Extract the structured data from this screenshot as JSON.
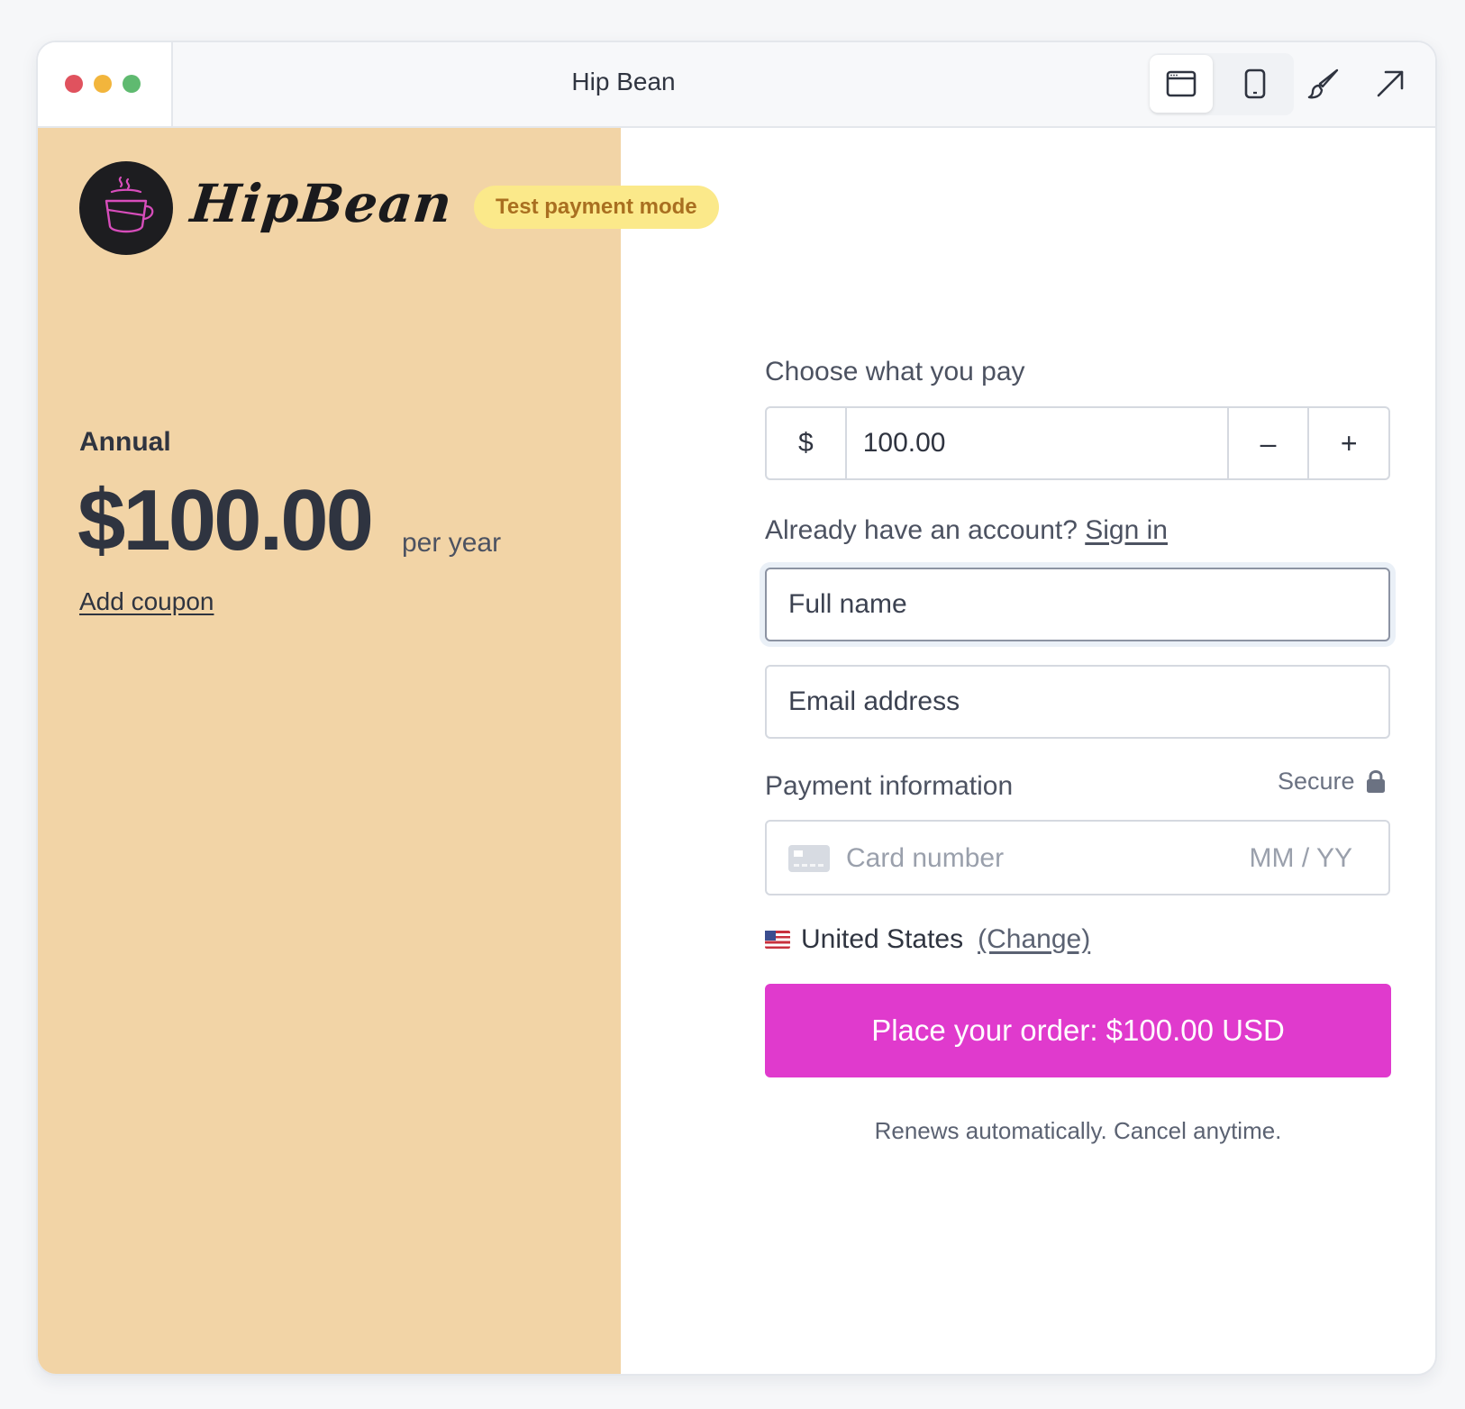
{
  "window": {
    "title": "Hip Bean",
    "toolbar": {
      "desktop_icon": "browser-window-icon",
      "mobile_icon": "mobile-phone-icon",
      "customize_icon": "paintbrush-icon",
      "open_icon": "arrow-up-right-icon"
    }
  },
  "brand": {
    "name": "HipBean",
    "logo_icon": "coffee-cup-icon",
    "test_badge": "Test payment mode",
    "panel_color": "#f2d4a6"
  },
  "plan": {
    "name": "Annual",
    "price": "$100.00",
    "period": "per year",
    "coupon_link": "Add coupon"
  },
  "form": {
    "pwyw_label": "Choose what you pay",
    "currency_symbol": "$",
    "amount": "100.00",
    "decrement_label": "–",
    "increment_label": "+",
    "account_prompt": "Already have an account?",
    "signin_link": "Sign in",
    "full_name_placeholder": "Full name",
    "email_placeholder": "Email address",
    "payment_label": "Payment information",
    "secure_label": "Secure",
    "card_number_placeholder": "Card number",
    "card_expiry_placeholder": "MM / YY",
    "country": "United States",
    "country_change": "(Change)",
    "submit_label": "Place your order: $100.00 USD",
    "submit_color": "#e03acd",
    "renew_note": "Renews automatically. Cancel anytime."
  }
}
